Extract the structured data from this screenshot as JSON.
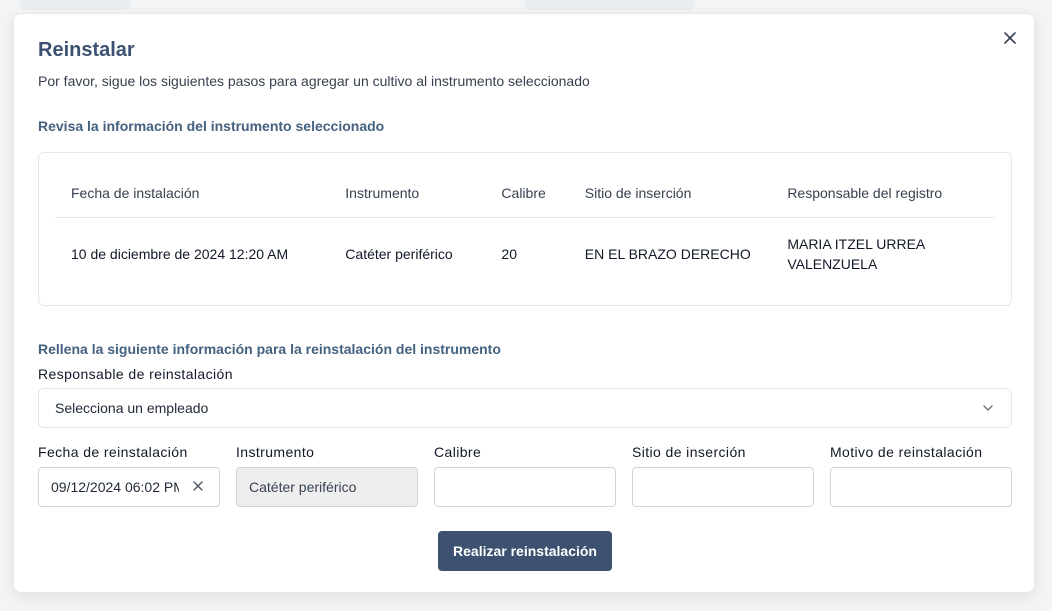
{
  "modal": {
    "title": "Reinstalar",
    "subtitle": "Por favor, sigue los siguientes pasos para agregar un cultivo al instrumento seleccionado"
  },
  "review_section": {
    "heading": "Revisa la información del instrumento seleccionado",
    "columns": [
      "Fecha de instalación",
      "Instrumento",
      "Calibre",
      "Sitio de inserción",
      "Responsable del registro"
    ],
    "row": {
      "fecha": "10 de diciembre de 2024 12:20 AM",
      "instrumento": "Catéter periférico",
      "calibre": "20",
      "sitio": "EN EL BRAZO DERECHO",
      "responsable": "MARIA ITZEL URREA VALENZUELA"
    }
  },
  "form_section": {
    "heading": "Rellena la siguiente información para la reinstalación del instrumento",
    "responsable_label": "Responsable de reinstalación",
    "responsable_selected": "Selecciona un empleado",
    "fecha_label": "Fecha de reinstalación",
    "fecha_value": "09/12/2024 06:02 PM",
    "instrumento_label": "Instrumento",
    "instrumento_value": "Catéter periférico",
    "calibre_label": "Calibre",
    "calibre_value": "",
    "sitio_label": "Sitio de inserción",
    "sitio_value": "",
    "motivo_label": "Motivo de reinstalación",
    "motivo_value": ""
  },
  "actions": {
    "submit_label": "Realizar reinstalación"
  },
  "icons": {
    "close": "close-icon",
    "dropdown": "chevron-down-icon",
    "clear": "clear-icon"
  },
  "colors": {
    "accent": "#3d5171",
    "heading": "#44617f",
    "border": "#e5e7eb"
  }
}
